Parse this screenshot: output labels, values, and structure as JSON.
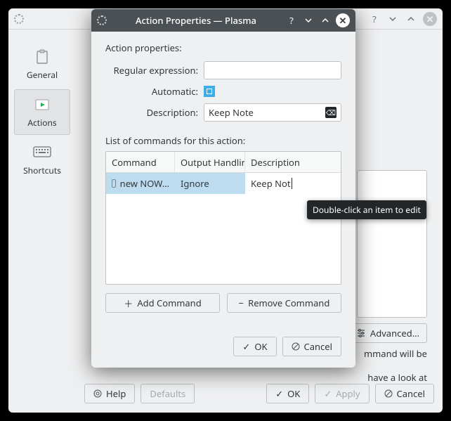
{
  "back": {
    "sidebar": {
      "items": [
        {
          "label": "General"
        },
        {
          "label": "Actions"
        },
        {
          "label": "Shortcuts"
        }
      ]
    },
    "advanced_label": "Advanced…",
    "hint_line1": "mmand will be",
    "hint_line2": "have a look at",
    "buttons": {
      "help": "Help",
      "defaults": "Defaults",
      "ok": "OK",
      "apply": "Apply",
      "cancel": "Cancel"
    }
  },
  "dialog": {
    "title": "Action Properties — Plasma",
    "section_title": "Action properties:",
    "labels": {
      "regex": "Regular expression:",
      "automatic": "Automatic:",
      "description": "Description:"
    },
    "values": {
      "regex": "",
      "automatic": true,
      "description": "Keep Note"
    },
    "list_label": "List of commands for this action:",
    "columns": {
      "command": "Command",
      "output": "Output Handling",
      "description": "Description"
    },
    "rows": [
      {
        "command": "new NOW…",
        "output": "Ignore",
        "description": "Keep Not"
      }
    ],
    "cmd_buttons": {
      "add": "Add Command",
      "remove": "Remove Command"
    },
    "footer": {
      "ok": "OK",
      "cancel": "Cancel"
    }
  },
  "tooltip": "Double-click an item to edit"
}
